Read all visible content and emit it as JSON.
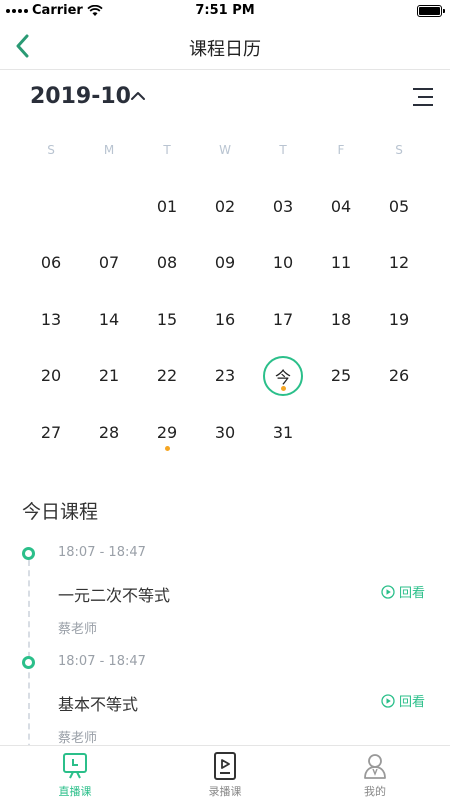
{
  "status_bar": {
    "carrier": "Carrier",
    "time": "7:51 PM"
  },
  "nav": {
    "title": "课程日历"
  },
  "calendar": {
    "month": "2019-10",
    "weekdays": [
      "S",
      "M",
      "T",
      "W",
      "T",
      "F",
      "S"
    ],
    "leading_blanks": 2,
    "days": [
      {
        "label": "01",
        "today": false,
        "dot": false
      },
      {
        "label": "02",
        "today": false,
        "dot": false
      },
      {
        "label": "03",
        "today": false,
        "dot": false
      },
      {
        "label": "04",
        "today": false,
        "dot": false
      },
      {
        "label": "05",
        "today": false,
        "dot": false
      },
      {
        "label": "06",
        "today": false,
        "dot": false
      },
      {
        "label": "07",
        "today": false,
        "dot": false
      },
      {
        "label": "08",
        "today": false,
        "dot": false
      },
      {
        "label": "09",
        "today": false,
        "dot": false
      },
      {
        "label": "10",
        "today": false,
        "dot": false
      },
      {
        "label": "11",
        "today": false,
        "dot": false
      },
      {
        "label": "12",
        "today": false,
        "dot": false
      },
      {
        "label": "13",
        "today": false,
        "dot": false
      },
      {
        "label": "14",
        "today": false,
        "dot": false
      },
      {
        "label": "15",
        "today": false,
        "dot": false
      },
      {
        "label": "16",
        "today": false,
        "dot": false
      },
      {
        "label": "17",
        "today": false,
        "dot": false
      },
      {
        "label": "18",
        "today": false,
        "dot": false
      },
      {
        "label": "19",
        "today": false,
        "dot": false
      },
      {
        "label": "20",
        "today": false,
        "dot": false
      },
      {
        "label": "21",
        "today": false,
        "dot": false
      },
      {
        "label": "22",
        "today": false,
        "dot": false
      },
      {
        "label": "23",
        "today": false,
        "dot": false
      },
      {
        "label": "今",
        "today": true,
        "dot": true
      },
      {
        "label": "25",
        "today": false,
        "dot": false
      },
      {
        "label": "26",
        "today": false,
        "dot": false
      },
      {
        "label": "27",
        "today": false,
        "dot": false
      },
      {
        "label": "28",
        "today": false,
        "dot": false
      },
      {
        "label": "29",
        "today": false,
        "dot": true
      },
      {
        "label": "30",
        "today": false,
        "dot": false
      },
      {
        "label": "31",
        "today": false,
        "dot": false
      }
    ]
  },
  "today_section": {
    "title": "今日课程",
    "courses": [
      {
        "time": "18:07 - 18:47",
        "name": "一元二次不等式",
        "teacher": "蔡老师",
        "action": "回看"
      },
      {
        "time": "18:07 - 18:47",
        "name": "基本不等式",
        "teacher": "蔡老师",
        "action": "回看"
      }
    ]
  },
  "tabbar": {
    "tabs": [
      {
        "label": "直播课",
        "icon": "live-class-icon",
        "active": true
      },
      {
        "label": "录播课",
        "icon": "recorded-class-icon",
        "active": false
      },
      {
        "label": "我的",
        "icon": "profile-icon",
        "active": false
      }
    ]
  },
  "colors": {
    "accent": "#2bbf8a",
    "dot": "#f5a623",
    "muted": "#9aa0a8"
  }
}
